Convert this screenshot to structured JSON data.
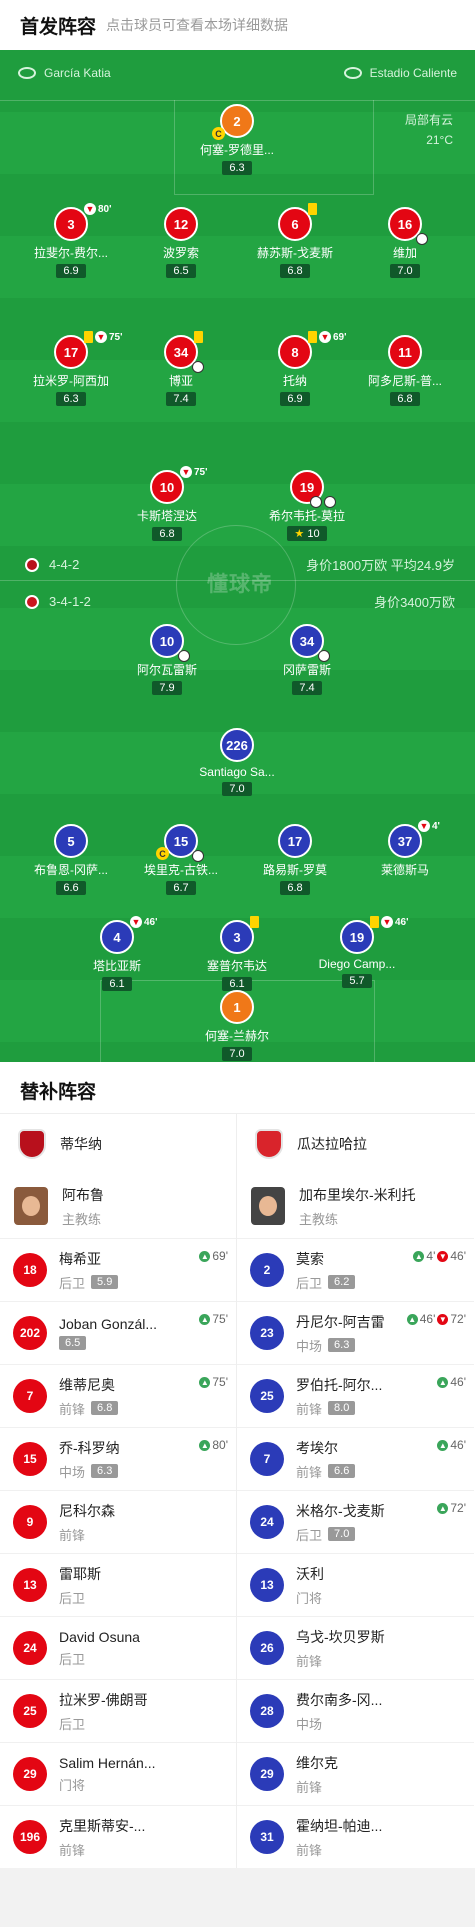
{
  "header": {
    "title": "首发阵容",
    "hint": "点击球员可查看本场详细数据"
  },
  "venue": {
    "referee": "García Katia",
    "stadium": "Estadio Caliente",
    "weather": "局部有云",
    "temp": "21°C"
  },
  "watermark": "懂球帝",
  "home": {
    "formation": "4-4-2",
    "value": "身价1800万欧  平均24.9岁",
    "players": [
      {
        "num": "2",
        "name": "何塞-罗德里...",
        "rating": "6.3",
        "role": "keeper",
        "events": {
          "captain": "C"
        }
      },
      {
        "num": "3",
        "name": "拉斐尔-费尔...",
        "rating": "6.9",
        "events": {
          "subout": "80'"
        }
      },
      {
        "num": "12",
        "name": "波罗索",
        "rating": "6.5"
      },
      {
        "num": "6",
        "name": "赫苏斯-戈麦斯",
        "rating": "6.8",
        "events": {
          "ycard": true
        }
      },
      {
        "num": "16",
        "name": "维加",
        "rating": "7.0",
        "events": {
          "ball": true
        }
      },
      {
        "num": "17",
        "name": "拉米罗-阿西加",
        "rating": "6.3",
        "events": {
          "ycard": true,
          "subout": "75'"
        }
      },
      {
        "num": "34",
        "name": "博亚",
        "rating": "7.4",
        "events": {
          "ycard": true,
          "goal": true
        }
      },
      {
        "num": "8",
        "name": "托纳",
        "rating": "6.9",
        "events": {
          "ycard": true,
          "subout": "69'"
        }
      },
      {
        "num": "11",
        "name": "阿多尼斯-普...",
        "rating": "6.8"
      },
      {
        "num": "10",
        "name": "卡斯塔涅达",
        "rating": "6.8",
        "events": {
          "subout": "75'"
        }
      },
      {
        "num": "19",
        "name": "希尔韦托-莫拉",
        "rating": "10",
        "events": {
          "goals": 2,
          "star": true
        }
      }
    ]
  },
  "away": {
    "formation": "3-4-1-2",
    "value": "身价3400万欧",
    "players": [
      {
        "num": "10",
        "name": "阿尔瓦雷斯",
        "rating": "7.9",
        "events": {
          "goal": true
        }
      },
      {
        "num": "34",
        "name": "冈萨雷斯",
        "rating": "7.4",
        "events": {
          "goal": true
        }
      },
      {
        "num": "226",
        "name": "Santiago Sa...",
        "rating": "7.0"
      },
      {
        "num": "5",
        "name": "布鲁恩-冈萨...",
        "rating": "6.6"
      },
      {
        "num": "15",
        "name": "埃里克-古铁...",
        "rating": "6.7",
        "events": {
          "captain": "C",
          "ball": true
        }
      },
      {
        "num": "17",
        "name": "路易斯-罗莫",
        "rating": "6.8"
      },
      {
        "num": "37",
        "name": "莱德斯马",
        "rating": "",
        "events": {
          "subout": "4'"
        }
      },
      {
        "num": "4",
        "name": "塔比亚斯",
        "rating": "6.1",
        "events": {
          "subout": "46'"
        }
      },
      {
        "num": "3",
        "name": "塞普尔韦达",
        "rating": "6.1",
        "events": {
          "ycard": true
        }
      },
      {
        "num": "19",
        "name": "Diego Camp...",
        "rating": "5.7",
        "events": {
          "ycard": true,
          "subout": "46'"
        }
      },
      {
        "num": "1",
        "name": "何塞-兰赫尔",
        "rating": "7.0",
        "role": "keeper"
      }
    ]
  },
  "subs": {
    "title": "替补阵容",
    "home": {
      "team": "蒂华纳",
      "coach": {
        "name": "阿布鲁",
        "role": "主教练"
      },
      "players": [
        {
          "num": "18",
          "name": "梅希亚",
          "pos": "后卫",
          "rating": "5.9",
          "ev": "69'"
        },
        {
          "num": "202",
          "name": "Joban Gonzál...",
          "pos": "",
          "rating": "6.5",
          "ev": "75'"
        },
        {
          "num": "7",
          "name": "维蒂尼奥",
          "pos": "前锋",
          "rating": "6.8",
          "ev": "75'"
        },
        {
          "num": "15",
          "name": "乔-科罗纳",
          "pos": "中场",
          "rating": "6.3",
          "ev": "80'"
        },
        {
          "num": "9",
          "name": "尼科尔森",
          "pos": "前锋",
          "rating": "",
          "ev": ""
        },
        {
          "num": "13",
          "name": "雷耶斯",
          "pos": "后卫",
          "rating": "",
          "ev": ""
        },
        {
          "num": "24",
          "name": "David Osuna",
          "pos": "后卫",
          "rating": "",
          "ev": ""
        },
        {
          "num": "25",
          "name": "拉米罗-佛朗哥",
          "pos": "后卫",
          "rating": "",
          "ev": ""
        },
        {
          "num": "29",
          "name": "Salim Hernán...",
          "pos": "门将",
          "rating": "",
          "ev": ""
        },
        {
          "num": "196",
          "name": "克里斯蒂安-...",
          "pos": "前锋",
          "rating": "",
          "ev": ""
        }
      ]
    },
    "away": {
      "team": "瓜达拉哈拉",
      "coach": {
        "name": "加布里埃尔-米利托",
        "role": "主教练"
      },
      "players": [
        {
          "num": "2",
          "name": "莫索",
          "pos": "后卫",
          "rating": "6.2",
          "ev": "4'",
          "ev2": "46'"
        },
        {
          "num": "23",
          "name": "丹尼尔-阿吉雷",
          "pos": "中场",
          "rating": "6.3",
          "ev": "46'",
          "ev2": "72'"
        },
        {
          "num": "25",
          "name": "罗伯托-阿尔...",
          "pos": "前锋",
          "rating": "8.0",
          "ev": "46'"
        },
        {
          "num": "7",
          "name": "考埃尔",
          "pos": "前锋",
          "rating": "6.6",
          "ev": "46'"
        },
        {
          "num": "24",
          "name": "米格尔-戈麦斯",
          "pos": "后卫",
          "rating": "7.0",
          "ev": "72'"
        },
        {
          "num": "13",
          "name": "沃利",
          "pos": "门将",
          "rating": "",
          "ev": ""
        },
        {
          "num": "26",
          "name": "乌戈-坎贝罗斯",
          "pos": "前锋",
          "rating": "",
          "ev": ""
        },
        {
          "num": "28",
          "name": "费尔南多-冈...",
          "pos": "中场",
          "rating": "",
          "ev": ""
        },
        {
          "num": "29",
          "name": "维尔克",
          "pos": "前锋",
          "rating": "",
          "ev": ""
        },
        {
          "num": "31",
          "name": "霍纳坦-帕迪...",
          "pos": "前锋",
          "rating": "",
          "ev": ""
        }
      ]
    }
  }
}
